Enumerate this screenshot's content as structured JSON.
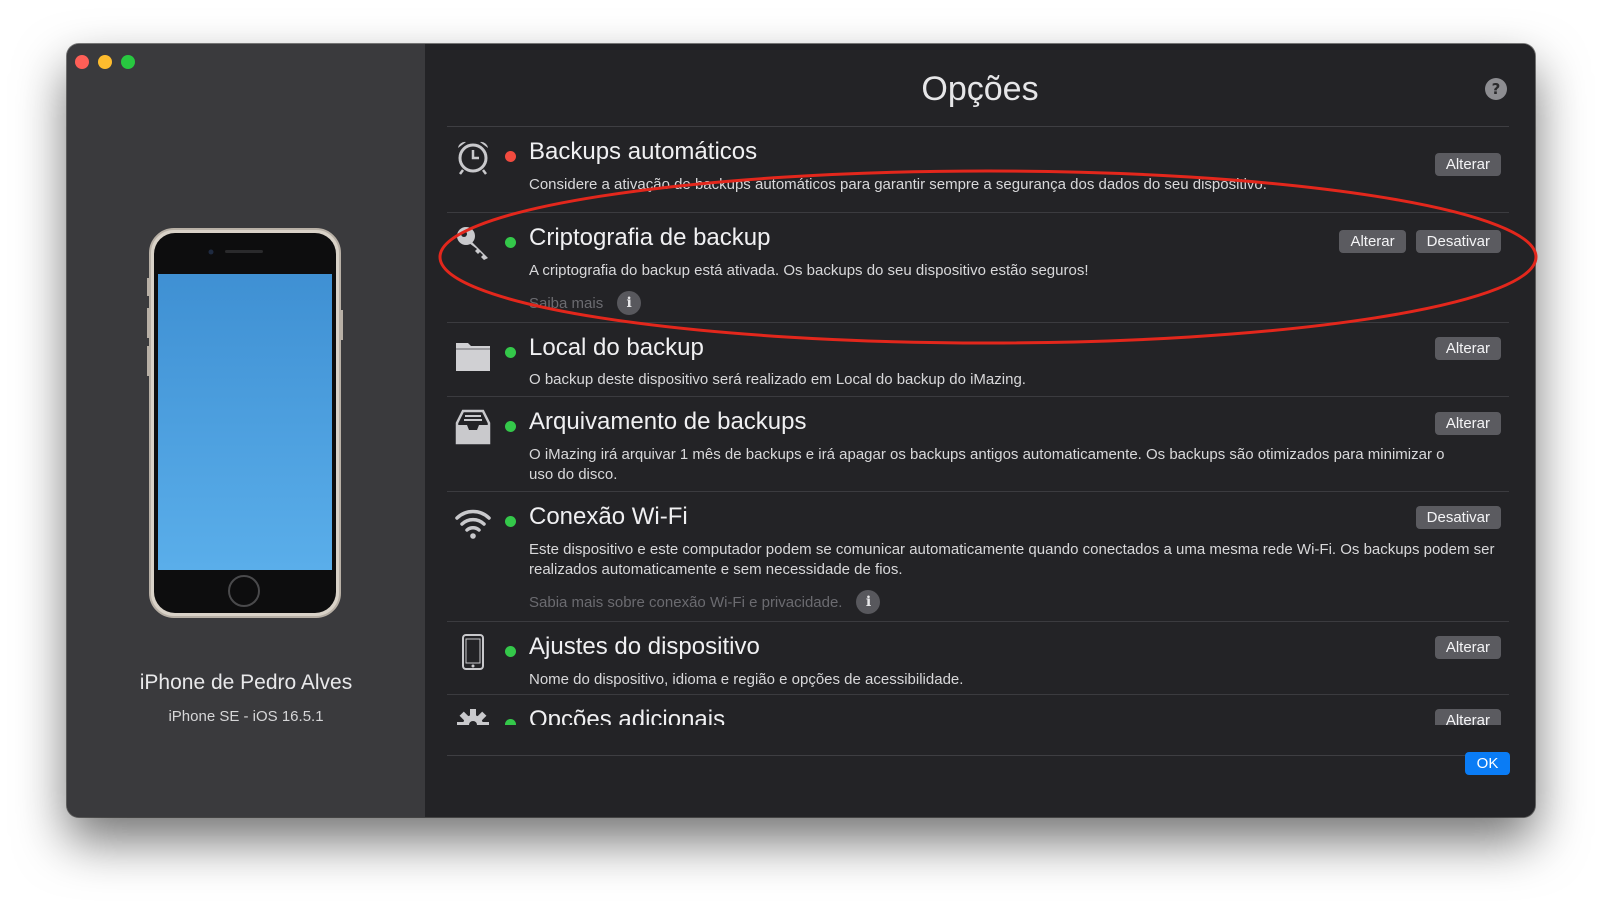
{
  "window": {
    "title": "Opções",
    "help_label": "?",
    "ok_label": "OK"
  },
  "device": {
    "name": "iPhone de Pedro Alves",
    "model": "iPhone SE - iOS 16.5.1",
    "screen_color_top": "#3f90d3",
    "screen_color_bottom": "#5aaeea"
  },
  "options": [
    {
      "icon": "alarm-clock-icon",
      "status": "red",
      "title": "Backups automáticos",
      "description": "Considere a ativação de backups automáticos para garantir sempre a segurança dos dados do seu dispositivo.",
      "buttons": [
        "Alterar"
      ]
    },
    {
      "icon": "key-icon",
      "status": "green",
      "title": "Criptografia de backup",
      "description": "A criptografia do backup está ativada. Os backups do seu dispositivo estão seguros!",
      "more": "Saiba mais",
      "buttons": [
        "Alterar",
        "Desativar"
      ]
    },
    {
      "icon": "folder-icon",
      "status": "green",
      "title": "Local do backup",
      "description": "O backup deste dispositivo será realizado em Local do backup do iMazing.",
      "buttons": [
        "Alterar"
      ]
    },
    {
      "icon": "archive-tray-icon",
      "status": "green",
      "title": "Arquivamento de backups",
      "description": "O iMazing irá arquivar 1 mês de backups e irá apagar os backups antigos automaticamente. Os backups são otimizados para minimizar o uso do disco.",
      "buttons": [
        "Alterar"
      ]
    },
    {
      "icon": "wifi-icon",
      "status": "green",
      "title": "Conexão Wi-Fi",
      "description": "Este dispositivo e este computador podem se comunicar automaticamente quando conectados a uma mesma rede Wi-Fi. Os backups podem ser realizados automaticamente e sem necessidade de fios.",
      "more": "Sabia mais sobre conexão Wi-Fi e privacidade.",
      "buttons": [
        "Desativar"
      ]
    },
    {
      "icon": "phone-icon",
      "status": "green",
      "title": "Ajustes do dispositivo",
      "description": "Nome do dispositivo, idioma e região e opções de acessibilidade.",
      "buttons": [
        "Alterar"
      ]
    },
    {
      "icon": "gear-icon",
      "status": "green",
      "title": "Opções adicionais",
      "description": "",
      "buttons": [
        "Alterar"
      ]
    }
  ],
  "colors": {
    "annotation": "#e3271c",
    "accent": "#0a7cf5",
    "status_red": "#f24b3f",
    "status_green": "#34c84a"
  }
}
